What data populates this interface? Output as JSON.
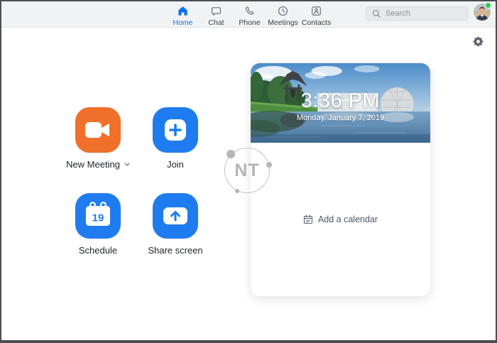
{
  "header": {
    "tabs": [
      {
        "label": "Home",
        "active": true
      },
      {
        "label": "Chat"
      },
      {
        "label": "Phone"
      },
      {
        "label": "Meetings"
      },
      {
        "label": "Contacts"
      }
    ],
    "search_placeholder": "Search"
  },
  "actions": [
    {
      "label": "New Meeting",
      "color": "#F0702B",
      "has_dropdown": true
    },
    {
      "label": "Join",
      "color": "#1F7CF0"
    },
    {
      "label": "Schedule",
      "color": "#1F7CF0",
      "calendar_day": "19"
    },
    {
      "label": "Share screen",
      "color": "#1F7CF0"
    }
  ],
  "clock_card": {
    "time": "3:36 PM",
    "date": "Monday, January 7, 2019",
    "add_calendar_label": "Add a calendar"
  },
  "watermark": {
    "text": "NT"
  },
  "colors": {
    "accent_blue": "#1F7CF0",
    "active_tab_blue": "#0E71EB",
    "new_meeting_orange": "#F0702B",
    "online_green": "#31C948",
    "header_bg": "#F1F2F4"
  }
}
